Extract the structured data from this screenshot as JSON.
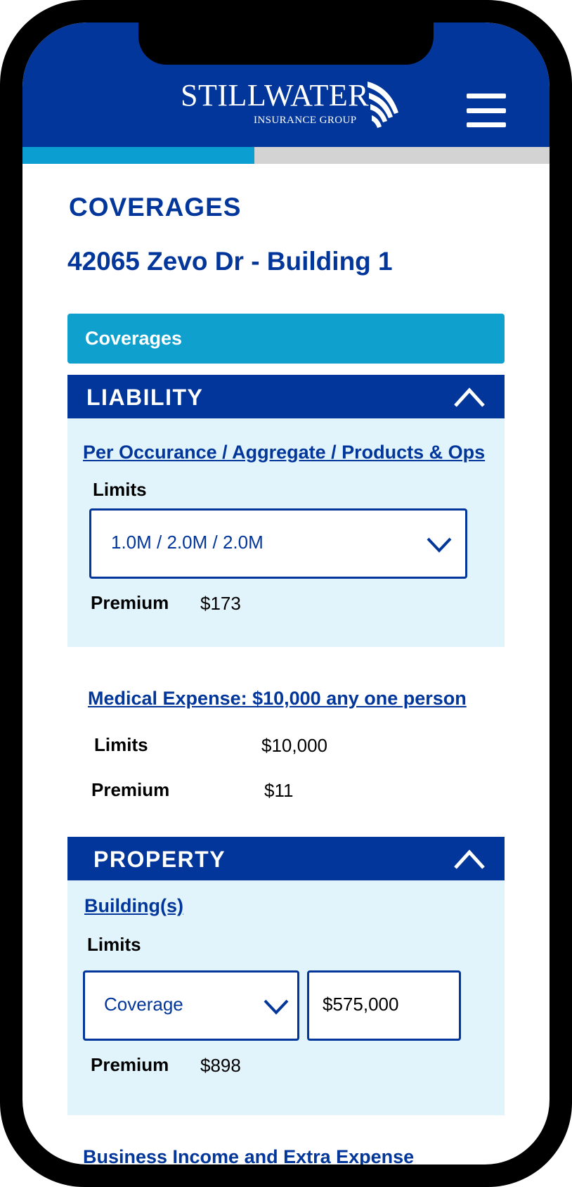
{
  "header": {
    "logo_name": "STILLWATER",
    "logo_sub": "INSURANCE GROUP",
    "menu_icon": "hamburger-menu-icon"
  },
  "progress": {
    "fraction": 0.44
  },
  "page": {
    "title": "COVERAGES",
    "address": "42065 Zevo Dr - Building 1",
    "banner": "Coverages"
  },
  "liability": {
    "title": "LIABILITY",
    "toggle_icon": "chevron-up-icon",
    "per_occurrence": {
      "link": "Per Occurance / Aggregate / Products & Ops",
      "limits_label": "Limits",
      "limits_value": "1.0M / 2.0M / 2.0M",
      "premium_label": "Premium",
      "premium_value": "$173"
    },
    "medical": {
      "link": "Medical Expense: $10,000 any one person",
      "limits_label": "Limits",
      "limits_value": "$10,000",
      "premium_label": "Premium",
      "premium_value": "$11"
    }
  },
  "property": {
    "title": "PROPERTY",
    "toggle_icon": "chevron-up-icon",
    "buildings": {
      "link": "Building(s)",
      "limits_label": "Limits",
      "coverage_select": "Coverage",
      "amount_value": "$575,000",
      "premium_label": "Premium",
      "premium_value": "$898"
    },
    "business_income_link": "Business Income and Extra Expense"
  },
  "colors": {
    "primary": "#02369a",
    "accent": "#0fa0cd",
    "panel_bg": "#e1f3fb",
    "progress_track": "#d3d3d3"
  }
}
